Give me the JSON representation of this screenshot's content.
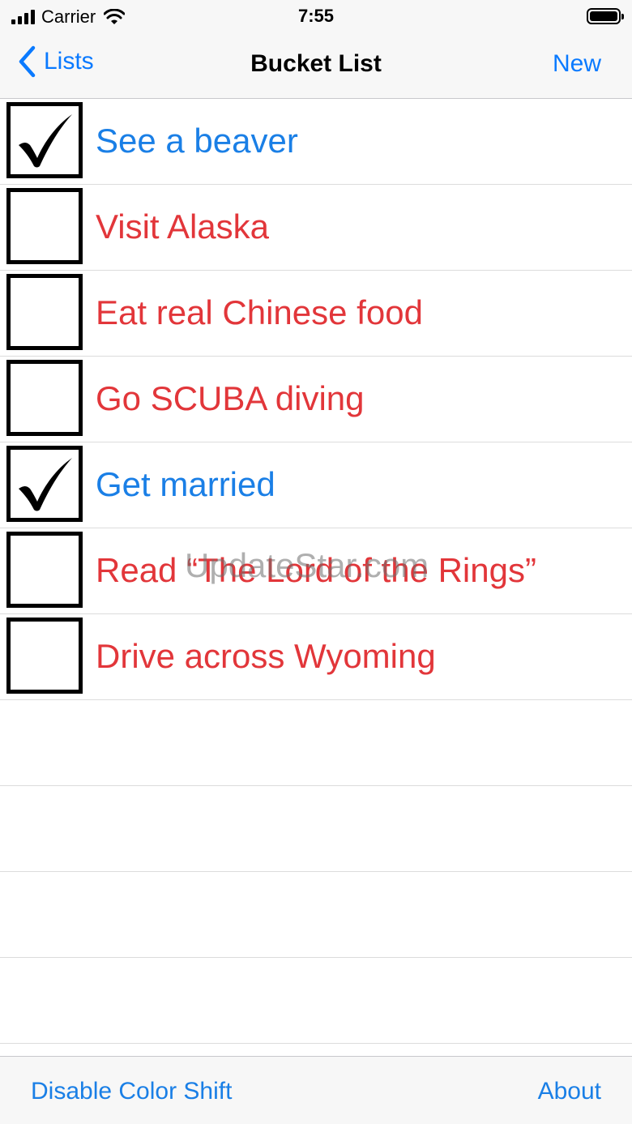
{
  "status_bar": {
    "carrier": "Carrier",
    "time": "7:55"
  },
  "nav": {
    "back_label": "Lists",
    "title": "Bucket List",
    "new_label": "New"
  },
  "items": [
    {
      "label": "See a beaver",
      "checked": true
    },
    {
      "label": "Visit Alaska",
      "checked": false
    },
    {
      "label": "Eat real Chinese food",
      "checked": false
    },
    {
      "label": "Go SCUBA diving",
      "checked": false
    },
    {
      "label": "Get married",
      "checked": true
    },
    {
      "label": "Read “The Lord of the Rings”",
      "checked": false
    },
    {
      "label": "Drive across Wyoming",
      "checked": false
    }
  ],
  "watermark": "UpdateStar.com",
  "toolbar": {
    "left_label": "Disable Color Shift",
    "right_label": "About"
  },
  "colors": {
    "accent": "#0a7aff",
    "checked_text": "#1a7fe6",
    "unchecked_text": "#e2363a"
  }
}
